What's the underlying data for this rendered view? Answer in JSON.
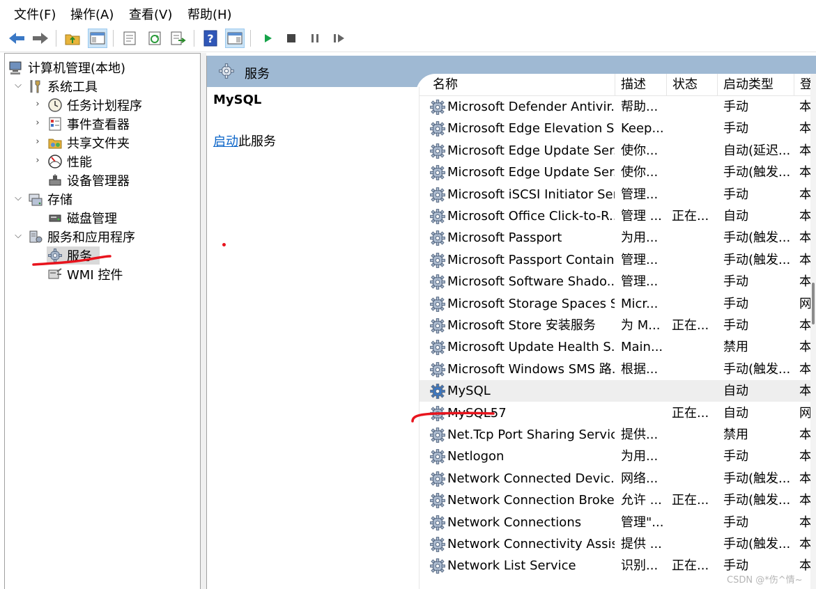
{
  "menu": [
    "文件(F)",
    "操作(A)",
    "查看(V)",
    "帮助(H)"
  ],
  "toolbar": {
    "buttons": [
      "back-icon",
      "forward-icon",
      "up-folder-icon",
      "show-hide-tree-icon",
      "properties-icon",
      "refresh-icon",
      "export-list-icon",
      "help-icon",
      "action-pane-icon",
      "play-icon",
      "stop-icon",
      "pause-icon",
      "resume-icon"
    ],
    "colors": {
      "arrow": "#3a78c5",
      "play": "#16a34a",
      "stop": "#444444"
    }
  },
  "tree": {
    "root": "计算机管理(本地)",
    "system_tools": "系统工具",
    "task_scheduler": "任务计划程序",
    "event_viewer": "事件查看器",
    "shared_folders": "共享文件夹",
    "performance": "性能",
    "device_manager": "设备管理器",
    "storage": "存储",
    "disk_management": "磁盘管理",
    "services_apps": "服务和应用程序",
    "services": "服务",
    "wmi": "WMI 控件"
  },
  "header": {
    "title": "服务"
  },
  "details": {
    "selected_service": "MySQL",
    "start_link": "启动",
    "start_suffix": "此服务"
  },
  "columns": {
    "name": "名称",
    "description": "描述",
    "status": "状态",
    "startup": "启动类型",
    "logon": "登"
  },
  "services": [
    {
      "name": "Microsoft Defender Antivir...",
      "desc": "帮助...",
      "status": "",
      "startup": "手动",
      "logon": "本"
    },
    {
      "name": "Microsoft Edge Elevation S...",
      "desc": "Keep...",
      "status": "",
      "startup": "手动",
      "logon": "本"
    },
    {
      "name": "Microsoft Edge Update Ser...",
      "desc": "使你...",
      "status": "",
      "startup": "自动(延迟...",
      "logon": "本"
    },
    {
      "name": "Microsoft Edge Update Ser...",
      "desc": "使你...",
      "status": "",
      "startup": "手动(触发...",
      "logon": "本"
    },
    {
      "name": "Microsoft iSCSI Initiator Ser...",
      "desc": "管理...",
      "status": "",
      "startup": "手动",
      "logon": "本"
    },
    {
      "name": "Microsoft Office Click-to-R...",
      "desc": "管理 ...",
      "status": "正在...",
      "startup": "自动",
      "logon": "本"
    },
    {
      "name": "Microsoft Passport",
      "desc": "为用...",
      "status": "",
      "startup": "手动(触发...",
      "logon": "本"
    },
    {
      "name": "Microsoft Passport Container",
      "desc": "管理...",
      "status": "",
      "startup": "手动(触发...",
      "logon": "本"
    },
    {
      "name": "Microsoft Software Shado...",
      "desc": "管理...",
      "status": "",
      "startup": "手动",
      "logon": "本"
    },
    {
      "name": "Microsoft Storage Spaces S...",
      "desc": "Micr...",
      "status": "",
      "startup": "手动",
      "logon": "网"
    },
    {
      "name": "Microsoft Store 安装服务",
      "desc": "为 M...",
      "status": "正在...",
      "startup": "手动",
      "logon": "本"
    },
    {
      "name": "Microsoft Update Health S...",
      "desc": "Main...",
      "status": "",
      "startup": "禁用",
      "logon": "本"
    },
    {
      "name": "Microsoft Windows SMS 路...",
      "desc": "根据...",
      "status": "",
      "startup": "手动(触发...",
      "logon": "本"
    },
    {
      "name": "MySQL",
      "desc": "",
      "status": "",
      "startup": "自动",
      "logon": "本",
      "selected": true
    },
    {
      "name": "MySQL57",
      "desc": "",
      "status": "正在...",
      "startup": "自动",
      "logon": "网"
    },
    {
      "name": "Net.Tcp Port Sharing Service",
      "desc": "提供...",
      "status": "",
      "startup": "禁用",
      "logon": "本"
    },
    {
      "name": "Netlogon",
      "desc": "为用...",
      "status": "",
      "startup": "手动",
      "logon": "本"
    },
    {
      "name": "Network Connected Devic...",
      "desc": "网络...",
      "status": "",
      "startup": "手动(触发...",
      "logon": "本"
    },
    {
      "name": "Network Connection Broker",
      "desc": "允许 ...",
      "status": "正在...",
      "startup": "手动(触发...",
      "logon": "本"
    },
    {
      "name": "Network Connections",
      "desc": "管理\"...",
      "status": "",
      "startup": "手动",
      "logon": "本"
    },
    {
      "name": "Network Connectivity Assis...",
      "desc": "提供 ...",
      "status": "",
      "startup": "手动(触发...",
      "logon": "本"
    },
    {
      "name": "Network List Service",
      "desc": "识别...",
      "status": "正在...",
      "startup": "手动",
      "logon": "本"
    }
  ],
  "watermark": "CSDN @*伤^情~",
  "annotation_color": "#e8141d"
}
